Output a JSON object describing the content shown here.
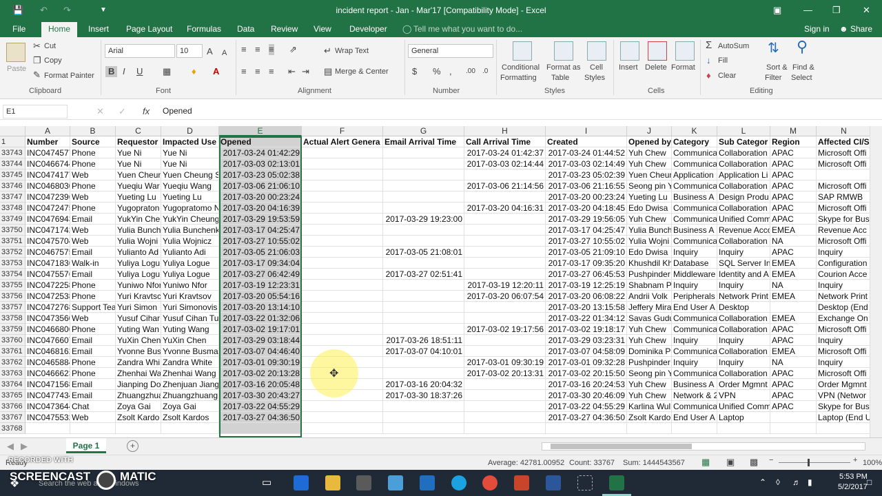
{
  "window": {
    "title": "incident report - Jan - Mar'17  [Compatibility Mode] - Excel"
  },
  "menu": {
    "tabs": [
      "File",
      "Home",
      "Insert",
      "Page Layout",
      "Formulas",
      "Data",
      "Review",
      "View",
      "Developer"
    ],
    "active_tab": "Home",
    "tell_me": "Tell me what you want to do...",
    "sign_in": "Sign in",
    "share": "Share"
  },
  "ribbon": {
    "clipboard": {
      "paste": "Paste",
      "cut": "Cut",
      "copy": "Copy",
      "format_painter": "Format Painter",
      "label": "Clipboard"
    },
    "font": {
      "name": "Arial",
      "size": "10",
      "bold": "B",
      "italic": "I",
      "underline": "U",
      "label": "Font"
    },
    "alignment": {
      "wrap": "Wrap Text",
      "merge": "Merge & Center",
      "label": "Alignment"
    },
    "number": {
      "format": "General",
      "label": "Number"
    },
    "styles": {
      "conditional": "Conditional",
      "conditional2": "Formatting",
      "format_table": "Format as",
      "format_table2": "Table",
      "cell_styles": "Cell",
      "cell_styles2": "Styles",
      "label": "Styles"
    },
    "cells": {
      "insert": "Insert",
      "delete": "Delete",
      "format": "Format",
      "label": "Cells"
    },
    "editing": {
      "autosum": "AutoSum",
      "fill": "Fill",
      "clear": "Clear",
      "sort": "Sort &",
      "sort2": "Filter",
      "find": "Find &",
      "find2": "Select",
      "label": "Editing"
    }
  },
  "formula_bar": {
    "name_box": "E1",
    "fx": "fx",
    "content": "Opened"
  },
  "sheet": {
    "columns": [
      "A",
      "B",
      "C",
      "D",
      "E",
      "F",
      "G",
      "H",
      "I",
      "J",
      "K",
      "L",
      "M",
      "N"
    ],
    "selected_column": "E",
    "header_row": {
      "num": "1",
      "cells": [
        "Number",
        "Source",
        "Requestor",
        "Impacted Use",
        "Opened",
        "Actual Alert Genera",
        "Email Arrival Time",
        "Call Arrival Time",
        "Created",
        "Opened by",
        "Category",
        "Sub Categor",
        "Region",
        "Affected CI/S"
      ]
    },
    "rows": [
      {
        "num": "33743",
        "cells": [
          "INC0474577",
          "Phone",
          "Yue Ni",
          "Yue Ni",
          "2017-03-24 01:42:29",
          "",
          "",
          "2017-03-24 01:42:37",
          "2017-03-24 01:44:52",
          "Yuh Chew",
          "Communica",
          "Collaboration",
          "APAC",
          "Microsoft Offi"
        ]
      },
      {
        "num": "33744",
        "cells": [
          "INC0466744",
          "Phone",
          "Yue Ni",
          "Yue Ni",
          "2017-03-03 02:13:01",
          "",
          "",
          "2017-03-03 02:14:44",
          "2017-03-03 02:14:49",
          "Yuh Chew",
          "Communica",
          "Collaboration",
          "APAC",
          "Microsoft Offi"
        ]
      },
      {
        "num": "33745",
        "cells": [
          "INC0474177",
          "Web",
          "Yuen Cheun",
          "Yuen Cheung S",
          "2017-03-23 05:02:38",
          "",
          "",
          "",
          "2017-03-23 05:02:39",
          "Yuen Cheun",
          "Application",
          "Application Li",
          "APAC",
          ""
        ]
      },
      {
        "num": "33746",
        "cells": [
          "INC0468030",
          "Phone",
          "Yueqiu War",
          "Yueqiu Wang",
          "2017-03-06 21:06:10",
          "",
          "",
          "2017-03-06 21:14:56",
          "2017-03-06 21:16:55",
          "Seong pin Y",
          "Communica",
          "Collaboration",
          "APAC",
          "Microsoft Offi"
        ]
      },
      {
        "num": "33747",
        "cells": [
          "INC0472396",
          "Web",
          "Yueting Lu",
          "Yueting Lu",
          "2017-03-20 00:23:24",
          "",
          "",
          "",
          "2017-03-20 00:23:24",
          "Yueting Lu",
          "Business A",
          "Design Produ",
          "APAC",
          "SAP RMWB"
        ]
      },
      {
        "num": "33748",
        "cells": [
          "INC0472475",
          "Phone",
          "Yugopraton",
          "Yugopratomo N",
          "2017-03-20 04:16:39",
          "",
          "",
          "2017-03-20 04:16:31",
          "2017-03-20 04:18:45",
          "Edo Dwisa",
          "Communica",
          "Collaboration",
          "APAC",
          "Microsoft Offi"
        ]
      },
      {
        "num": "33749",
        "cells": [
          "INC0476943",
          "Email",
          "YukYin Che",
          "YukYin Cheung",
          "2017-03-29 19:53:59",
          "",
          "2017-03-29 19:23:00",
          "",
          "2017-03-29 19:56:05",
          "Yuh Chew",
          "Communica",
          "Unified Comm",
          "APAC",
          "Skype for Bus"
        ]
      },
      {
        "num": "33750",
        "cells": [
          "INC0471742",
          "Web",
          "Yulia Bunch",
          "Yulia Bunchenk",
          "2017-03-17 04:25:47",
          "",
          "",
          "",
          "2017-03-17 04:25:47",
          "Yulia Bunch",
          "Business A",
          "Revenue Acco",
          "EMEA",
          "Revenue Acc"
        ]
      },
      {
        "num": "33751",
        "cells": [
          "INC0475704",
          "Web",
          "Yulia Wojni",
          "Yulia Wojnicz",
          "2017-03-27 10:55:02",
          "",
          "",
          "",
          "2017-03-27 10:55:02",
          "Yulia Wojni",
          "Communica",
          "Collaboration",
          "NA",
          "Microsoft Offi"
        ]
      },
      {
        "num": "33752",
        "cells": [
          "INC0467575",
          "Email",
          "Yulianto Ad",
          "Yulianto Adi",
          "2017-03-05 21:06:03",
          "",
          "2017-03-05 21:08:01",
          "",
          "2017-03-05 21:09:10",
          "Edo Dwisa",
          "Inquiry",
          "Inquiry",
          "APAC",
          "Inquiry"
        ]
      },
      {
        "num": "33753",
        "cells": [
          "INC0471836",
          "Walk-in",
          "Yuliya Logu",
          "Yuliya Logue",
          "2017-03-17 09:34:04",
          "",
          "",
          "",
          "2017-03-17 09:35:20",
          "Khushdil Kh",
          "Database",
          "SQL Server In",
          "EMEA",
          "Configuration"
        ]
      },
      {
        "num": "33754",
        "cells": [
          "INC0475576",
          "Email",
          "Yuliya Logu",
          "Yuliya Logue",
          "2017-03-27 06:42:49",
          "",
          "2017-03-27 02:51:41",
          "",
          "2017-03-27 06:45:53",
          "Pushpinder",
          "Middleware",
          "Identity and A",
          "EMEA",
          "Courion Acce"
        ]
      },
      {
        "num": "33755",
        "cells": [
          "INC0472258",
          "Phone",
          "Yuniwo Nfor",
          "Yuniwo Nfor",
          "2017-03-19 12:23:31",
          "",
          "",
          "2017-03-19 12:20:11",
          "2017-03-19 12:25:19",
          "Shabnam P",
          "Inquiry",
          "Inquiry",
          "NA",
          "Inquiry"
        ]
      },
      {
        "num": "33756",
        "cells": [
          "INC0472538",
          "Phone",
          "Yuri Kravtsc",
          "Yuri Kravtsov",
          "2017-03-20 05:54:16",
          "",
          "",
          "2017-03-20 06:07:54",
          "2017-03-20 06:08:22",
          "Andrii Volk",
          "Peripherals",
          "Network Print",
          "EMEA",
          "Network Print"
        ]
      },
      {
        "num": "33757",
        "cells": [
          "INC0472768",
          "Support Tea",
          "Yuri Simon",
          "Yuri Simonovis",
          "2017-03-20 13:14:10",
          "",
          "",
          "",
          "2017-03-20 13:15:58",
          "Jeffery Mira",
          "End User A",
          "Desktop",
          "",
          "Desktop (End"
        ]
      },
      {
        "num": "33758",
        "cells": [
          "INC0473560",
          "Web",
          "Yusuf Cihar",
          "Yusuf Cihan Tu",
          "2017-03-22 01:32:06",
          "",
          "",
          "",
          "2017-03-22 01:34:12",
          "Savas Gudu",
          "Communica",
          "Collaboration",
          "EMEA",
          "Exchange On"
        ]
      },
      {
        "num": "33759",
        "cells": [
          "INC0466806",
          "Phone",
          "Yuting Wan",
          "Yuting Wang",
          "2017-03-02 19:17:01",
          "",
          "",
          "2017-03-02 19:17:56",
          "2017-03-02 19:18:17",
          "Yuh Chew",
          "Communica",
          "Collaboration",
          "APAC",
          "Microsoft Offi"
        ]
      },
      {
        "num": "33760",
        "cells": [
          "INC0476607",
          "Email",
          "YuXin Chen",
          "YuXin Chen",
          "2017-03-29 03:18:44",
          "",
          "2017-03-26 18:51:11",
          "",
          "2017-03-29 03:23:31",
          "Yuh Chew",
          "Inquiry",
          "Inquiry",
          "APAC",
          "Inquiry"
        ]
      },
      {
        "num": "33761",
        "cells": [
          "INC0468162",
          "Email",
          "Yvonne Bus",
          "Yvonne Busma",
          "2017-03-07 04:46:40",
          "",
          "2017-03-07 04:10:01",
          "",
          "2017-03-07 04:58:09",
          "Dominika P",
          "Communica",
          "Collaboration",
          "EMEA",
          "Microsoft Offi"
        ]
      },
      {
        "num": "33762",
        "cells": [
          "INC0465884",
          "Phone",
          "Zandra Whi",
          "Zandra White",
          "2017-03-01 09:30:19",
          "",
          "",
          "2017-03-01 09:30:19",
          "2017-03-01 09:32:28",
          "Pushpinder",
          "Inquiry",
          "Inquiry",
          "NA",
          "Inquiry"
        ]
      },
      {
        "num": "33763",
        "cells": [
          "INC0466623",
          "Phone",
          "Zhenhai Wa",
          "Zhenhai Wang",
          "2017-03-02 20:13:28",
          "",
          "",
          "2017-03-02 20:13:31",
          "2017-03-02 20:15:50",
          "Seong pin Y",
          "Communica",
          "Collaboration",
          "APAC",
          "Microsoft Offi"
        ]
      },
      {
        "num": "33764",
        "cells": [
          "INC0471568",
          "Email",
          "Jianping Do",
          "Zhenjuan Jiang",
          "2017-03-16 20:05:48",
          "",
          "2017-03-16 20:04:32",
          "",
          "2017-03-16 20:24:53",
          "Yuh Chew",
          "Business A",
          "Order Mgmnt",
          "APAC",
          "Order Mgmnt"
        ]
      },
      {
        "num": "33765",
        "cells": [
          "INC0477434",
          "Email",
          "Zhuangzhua",
          "Zhuangzhuang",
          "2017-03-30 20:43:27",
          "",
          "2017-03-30 18:37:26",
          "",
          "2017-03-30 20:46:09",
          "Yuh Chew",
          "Network & 2",
          "VPN",
          "APAC",
          "VPN (Networ"
        ]
      },
      {
        "num": "33766",
        "cells": [
          "INC0473644",
          "Chat",
          "Zoya Gai",
          "Zoya Gai",
          "2017-03-22 04:55:29",
          "",
          "",
          "",
          "2017-03-22 04:55:29",
          "Karlina Wul",
          "Communica",
          "Unified Comm",
          "APAC",
          "Skype for Bus"
        ]
      },
      {
        "num": "33767",
        "cells": [
          "INC0475532",
          "Web",
          "Zsolt Kardo",
          "Zsolt Kardos",
          "2017-03-27 04:36:50",
          "",
          "",
          "",
          "2017-03-27 04:36:50",
          "Zsolt Kardo",
          "End User A",
          "Laptop",
          "",
          "Laptop (End U"
        ]
      },
      {
        "num": "33768",
        "cells": [
          "",
          "",
          "",
          "",
          "",
          "",
          "",
          "",
          "",
          "",
          "",
          "",
          "",
          ""
        ]
      }
    ]
  },
  "sheet_tabs": {
    "active": "Page 1",
    "add": "+"
  },
  "status": {
    "ready": "Ready",
    "average": "Average: 42781.00952",
    "count": "Count: 33767",
    "sum": "Sum: 1444543567",
    "zoom": "100%"
  },
  "taskbar": {
    "search": "Search the web and Windows",
    "time": "5:53 PM",
    "date": "5/2/2017"
  },
  "watermark": {
    "line1": "RECORDED WITH",
    "line2": "SCREENCAST",
    "line3": "MATIC"
  },
  "colors": {
    "excel_green": "#217346",
    "selected": "#d2d2d2"
  }
}
